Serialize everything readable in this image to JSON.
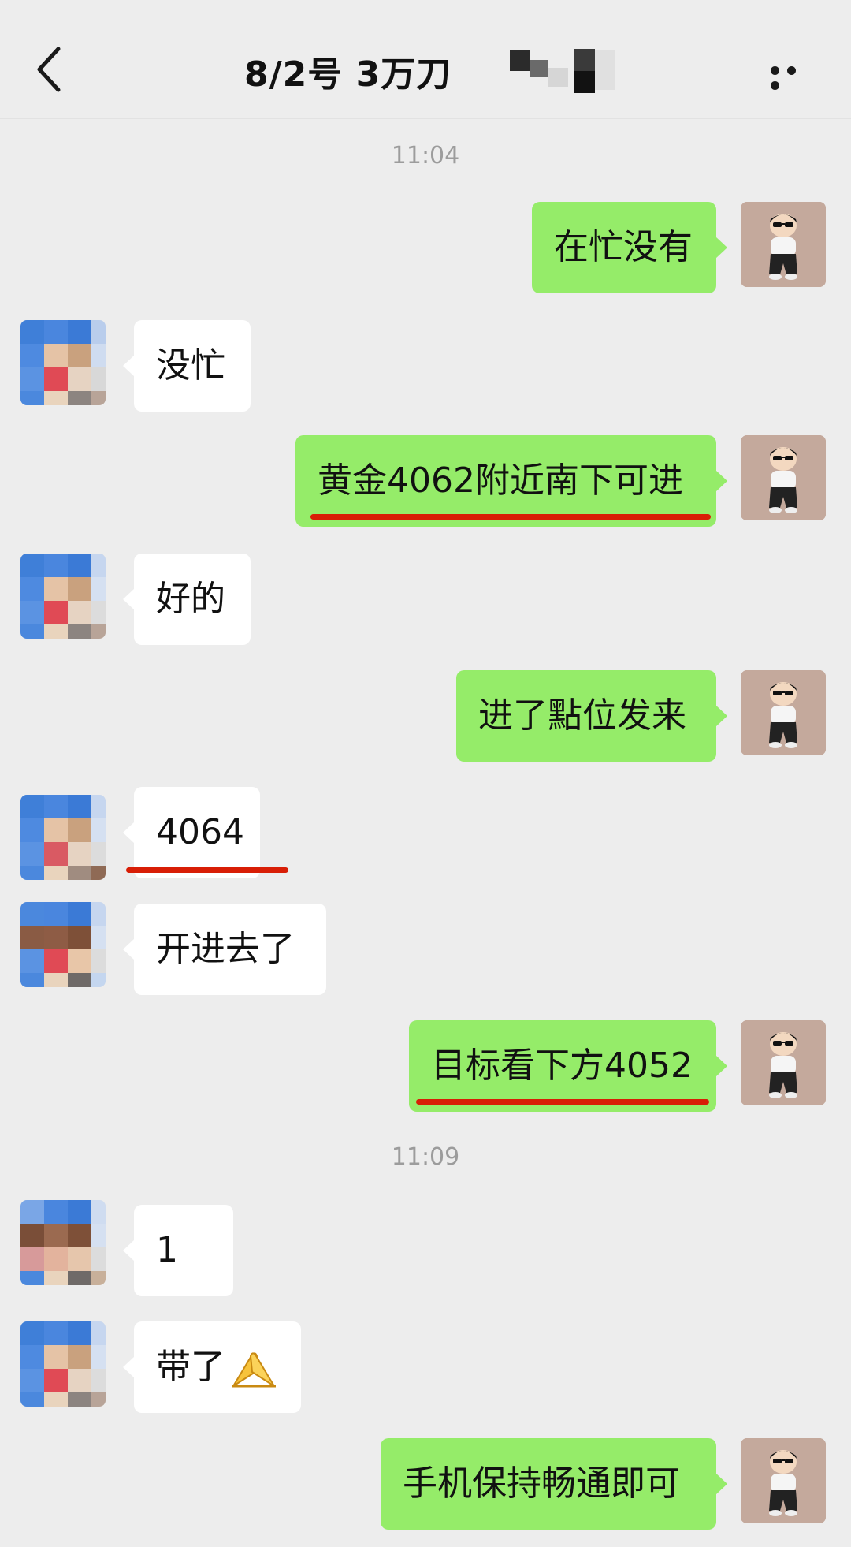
{
  "header": {
    "title": "8/2号  3万刀",
    "back_icon": "chevron-left-icon",
    "more_icon": "more-dots-icon"
  },
  "timestamps": [
    "11:04",
    "11:09"
  ],
  "messages": [
    {
      "sender": "me",
      "text": "在忙没有"
    },
    {
      "sender": "contact",
      "text": "没忙"
    },
    {
      "sender": "me",
      "text": "黄金4062附近南下可进",
      "highlighted": true
    },
    {
      "sender": "contact",
      "text": "好的"
    },
    {
      "sender": "me",
      "text": "进了點位发来"
    },
    {
      "sender": "contact",
      "text": "4064",
      "highlighted": true
    },
    {
      "sender": "contact",
      "text": "开进去了"
    },
    {
      "sender": "me",
      "text": "目标看下方4052",
      "highlighted": true
    },
    {
      "sender": "contact",
      "text": "1"
    },
    {
      "sender": "contact",
      "text": "带了",
      "emoji": "folded-hands-icon"
    },
    {
      "sender": "me",
      "text": "手机保持畅通即可"
    }
  ],
  "colors": {
    "background": "#ededed",
    "my_bubble": "#95ec69",
    "their_bubble": "#ffffff",
    "highlight_underline": "#d81e06",
    "timestamp": "#9c9c9c"
  }
}
